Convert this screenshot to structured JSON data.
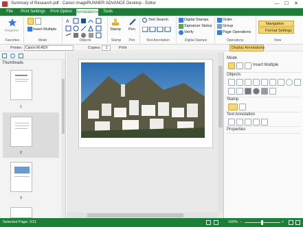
{
  "window": {
    "title": "Summary of Research.pdf - Canon imageRUNNER ADVANCE Desktop - Editor",
    "minimize_glyph": "—",
    "maximize_glyph": "☐",
    "close_glyph": "✕"
  },
  "ribbon_tabs": [
    {
      "label": "File"
    },
    {
      "label": "Print Settings"
    },
    {
      "label": "Print Option"
    },
    {
      "label": "Annotations"
    },
    {
      "label": "Tools"
    }
  ],
  "ribbon": {
    "register_label": "Register",
    "insert_multiple_label": "Insert Multiple",
    "stamp_label": "Stamp",
    "pen_label": "Pen",
    "text_search_label": "Text Search",
    "digital_stamps_label": "Digital Stamps",
    "signature_status_label": "Signature Status",
    "verify_label": "Verify",
    "order_label": "Order",
    "group_label": "Group",
    "page_operations_label": "Page Operations",
    "navigation_label": "Navigation",
    "format_settings_label": "Format Settings",
    "groups": {
      "favorites": "Favorites",
      "mode": "Mode",
      "objects": "Objects",
      "stamp": "Stamp",
      "pen": "Pen",
      "text_annotation": "Text Annotation",
      "digital_stamps": "Digital Stamps",
      "operations": "Operations",
      "view": "View"
    }
  },
  "toolbar": {
    "printer_label": "Printer:",
    "printer_value": "Canon iR-ADV",
    "copies_label": "Copies:",
    "copies_value": "1",
    "print_label": "Print",
    "display_annotations_label": "Display Annotations"
  },
  "left_pane": {
    "header": "Thumbnails",
    "pages": [
      {
        "label": "1"
      },
      {
        "label": "2"
      },
      {
        "label": "3"
      }
    ]
  },
  "right_pane": {
    "mode_label": "Mode",
    "insert_multiple_label": "Insert Multiple",
    "objects_label": "Objects",
    "stamp_label": "Stamp",
    "text_annotation_label": "Text Annotation",
    "properties_label": "Properties"
  },
  "status_bar": {
    "selected_page": "Selected Page: 2/11",
    "zoom": "100%"
  },
  "colors": {
    "accent": "#1e7d36",
    "highlight": "#f7d774"
  }
}
